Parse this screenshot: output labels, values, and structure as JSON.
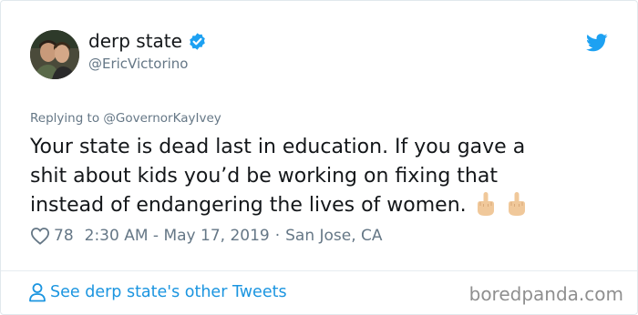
{
  "tweet": {
    "display_name": "derp state",
    "handle": "@EricVictorino",
    "reply_to": "Replying to @GovernorKayIvey",
    "text_lines": [
      "Your state is dead last in education. If you gave a",
      "shit about kids you’d be working on fixing that",
      "instead of endangering the lives of women."
    ],
    "emojis": [
      "middle-finger-emoji",
      "middle-finger-emoji"
    ],
    "likes": "78",
    "timestamp": "2:30 AM - May 17, 2019",
    "separator": "·",
    "location": "San Jose, CA",
    "see_other": "See derp state's other Tweets"
  },
  "icons": {
    "verified": "verified-badge-icon",
    "brand": "twitter-bird-icon",
    "like": "heart-outline-icon",
    "profile": "person-outline-icon"
  },
  "watermark": "boredpanda.com",
  "colors": {
    "twitter_blue": "#1da1f2",
    "link_blue": "#1b95e0",
    "secondary_text": "#657786",
    "primary_text": "#14171a",
    "emoji_skin": "#f0c89a"
  }
}
